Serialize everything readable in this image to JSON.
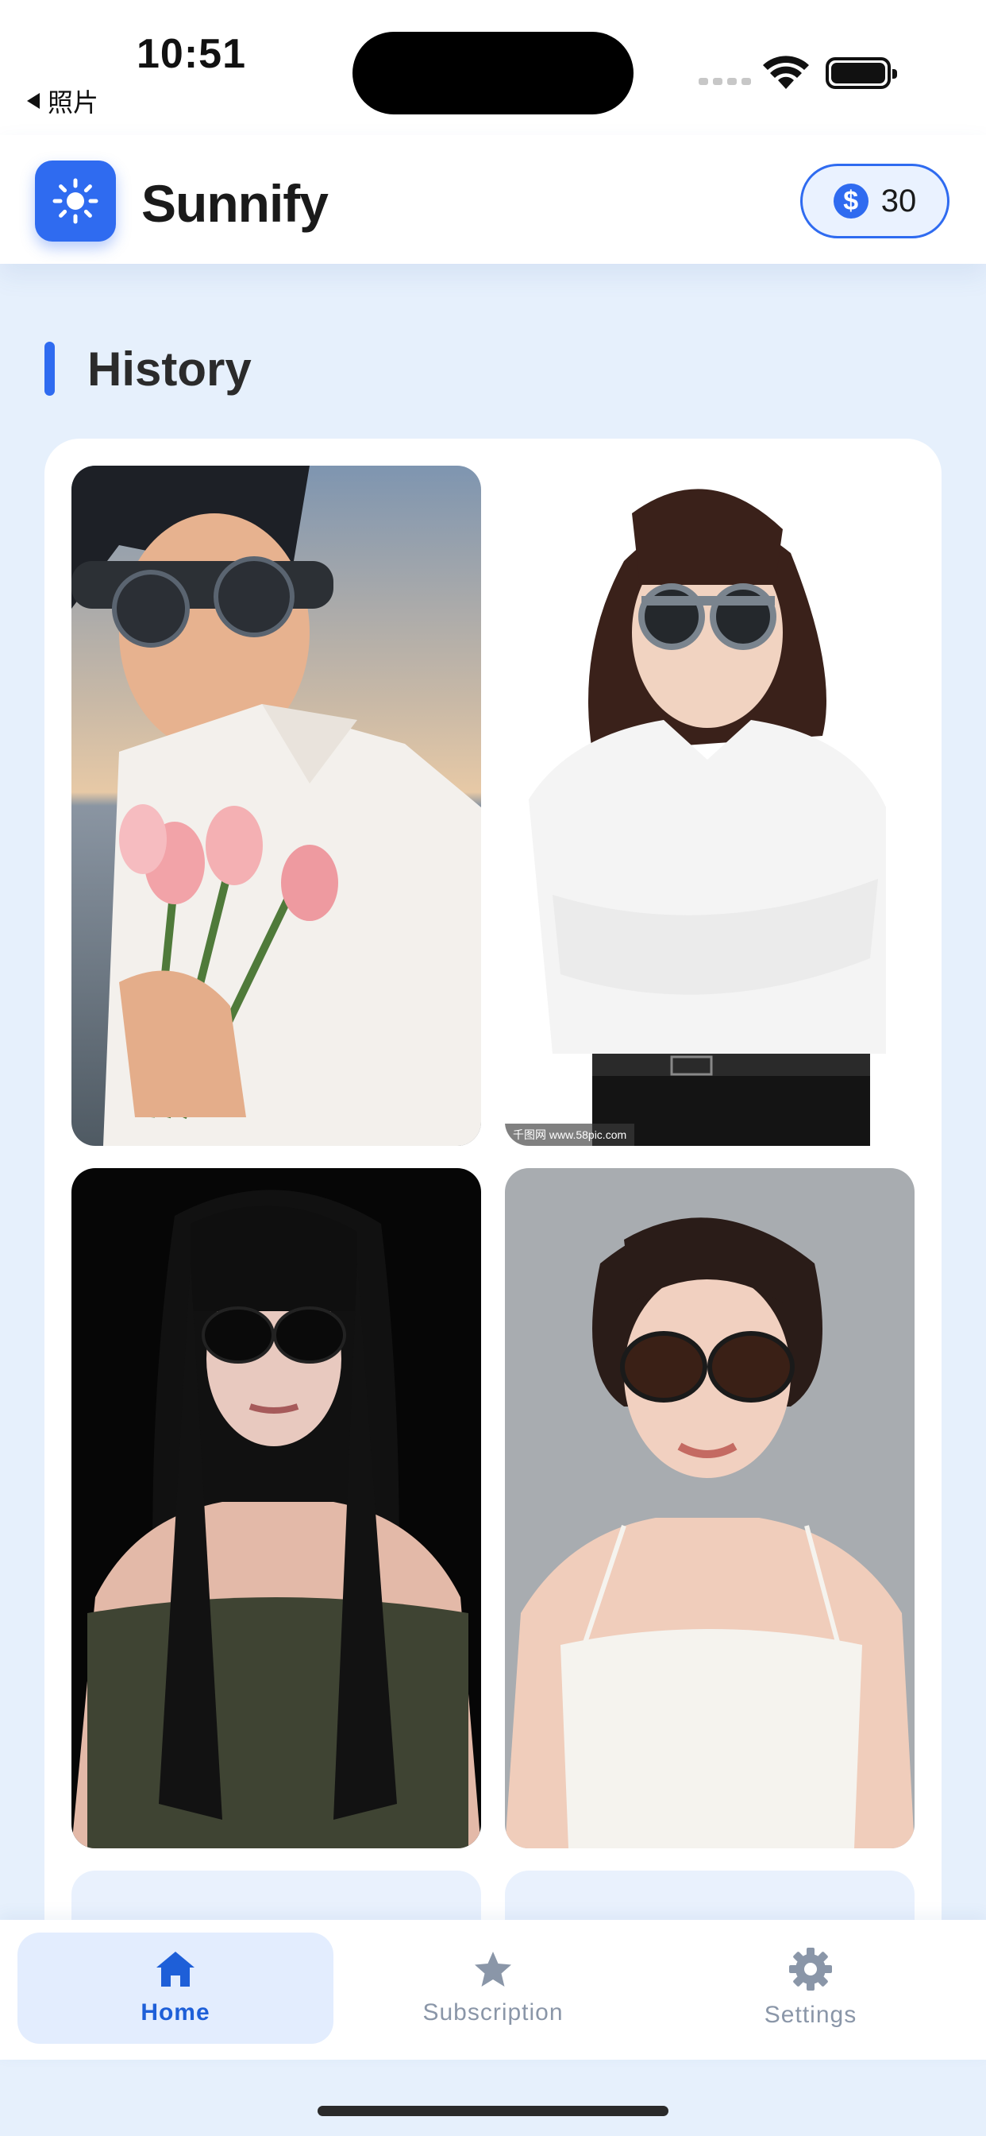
{
  "status_bar": {
    "time": "10:51",
    "back_label": "照片"
  },
  "header": {
    "app_name": "Sunnify",
    "credits": "30",
    "credit_icon": "$"
  },
  "section": {
    "title": "History"
  },
  "gallery": {
    "items": [
      {
        "icon": "photo-man-with-tulips"
      },
      {
        "icon": "photo-woman-white-shirt"
      },
      {
        "icon": "photo-woman-long-black-hair"
      },
      {
        "icon": "photo-woman-white-top"
      }
    ],
    "watermark": "千图网 www.58pic.com"
  },
  "tabs": [
    {
      "label": "Home",
      "icon": "home-icon",
      "active": true
    },
    {
      "label": "Subscription",
      "icon": "star-icon",
      "active": false
    },
    {
      "label": "Settings",
      "icon": "gear-icon",
      "active": false
    }
  ],
  "colors": {
    "accent": "#2f6bf0",
    "background": "#e6f0fc",
    "tab_active_bg": "#e3edfe",
    "tab_inactive": "#8a96a8"
  }
}
